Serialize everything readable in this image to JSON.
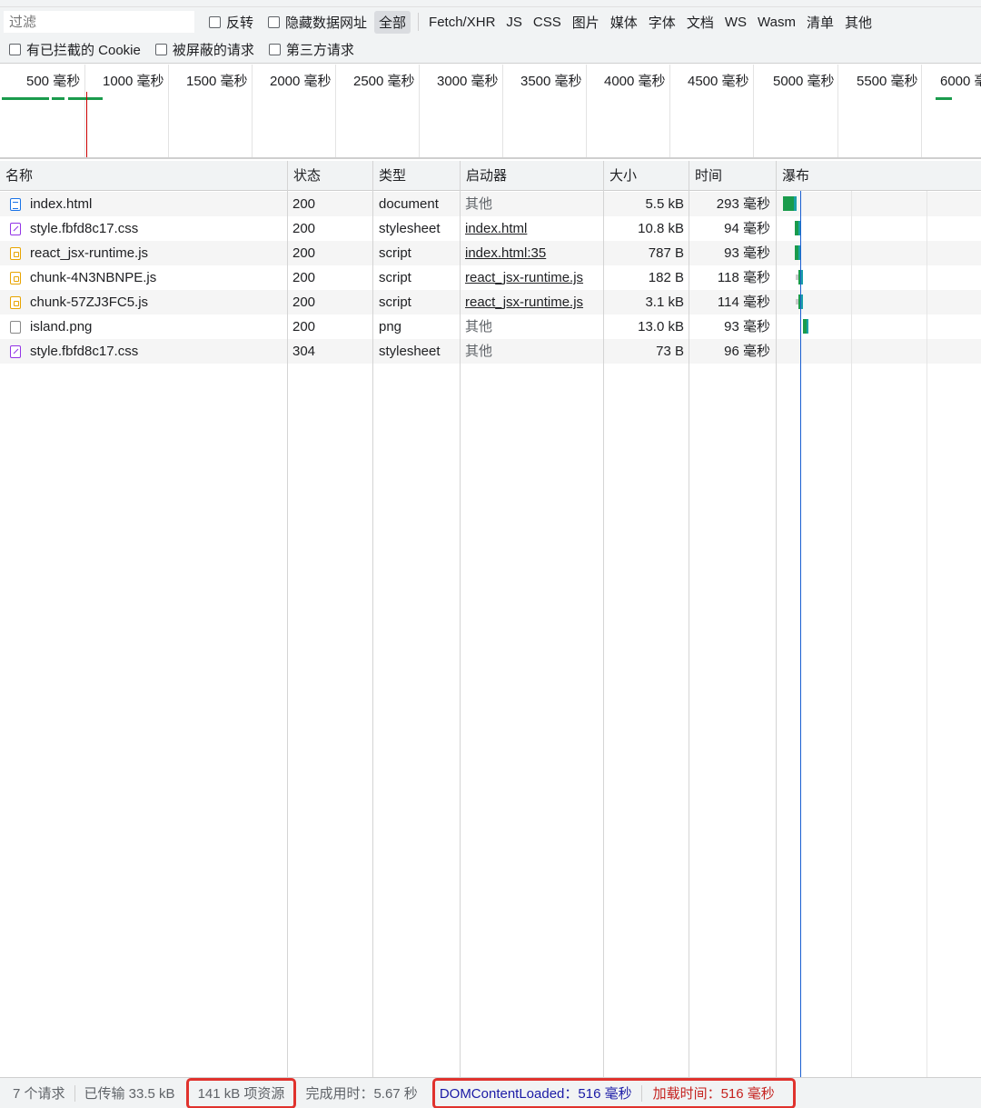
{
  "filter": {
    "placeholder": "过滤",
    "invert_label": "反转",
    "hide_data_urls_label": "隐藏数据网址",
    "types": [
      "全部",
      "Fetch/XHR",
      "JS",
      "CSS",
      "图片",
      "媒体",
      "字体",
      "文档",
      "WS",
      "Wasm",
      "清单",
      "其他"
    ],
    "blocked_cookies_label": "有已拦截的 Cookie",
    "blocked_requests_label": "被屏蔽的请求",
    "third_party_label": "第三方请求"
  },
  "overview": {
    "ticks": [
      "500 毫秒",
      "1000 毫秒",
      "1500 毫秒",
      "2000 毫秒",
      "2500 毫秒",
      "3000 毫秒",
      "3500 毫秒",
      "4000 毫秒",
      "4500 毫秒",
      "5000 毫秒",
      "5500 毫秒",
      "6000 毫"
    ]
  },
  "columns": {
    "name": "名称",
    "status": "状态",
    "type": "类型",
    "initiator": "启动器",
    "size": "大小",
    "time": "时间",
    "waterfall": "瀑布"
  },
  "rows": [
    {
      "name": "index.html",
      "icon": "document-icon",
      "status": "200",
      "type": "document",
      "initiator": "其他",
      "size": "5.5 kB",
      "time": "293 毫秒"
    },
    {
      "name": "style.fbfd8c17.css",
      "icon": "stylesheet-icon",
      "status": "200",
      "type": "stylesheet",
      "initiator": "index.html",
      "size": "10.8 kB",
      "time": "94 毫秒"
    },
    {
      "name": "react_jsx-runtime.js",
      "icon": "script-icon",
      "status": "200",
      "type": "script",
      "initiator": "index.html:35",
      "size": "787 B",
      "time": "93 毫秒"
    },
    {
      "name": "chunk-4N3NBNPE.js",
      "icon": "script-icon",
      "status": "200",
      "type": "script",
      "initiator": "react_jsx-runtime.js",
      "size": "182 B",
      "time": "118 毫秒"
    },
    {
      "name": "chunk-57ZJ3FC5.js",
      "icon": "script-icon",
      "status": "200",
      "type": "script",
      "initiator": "react_jsx-runtime.js",
      "size": "3.1 kB",
      "time": "114 毫秒"
    },
    {
      "name": "island.png",
      "icon": "image-icon",
      "status": "200",
      "type": "png",
      "initiator": "其他",
      "size": "13.0 kB",
      "time": "93 毫秒"
    },
    {
      "name": "style.fbfd8c17.css",
      "icon": "stylesheet-icon",
      "status": "304",
      "type": "stylesheet",
      "initiator": "其他",
      "size": "73 B",
      "time": "96 毫秒"
    }
  ],
  "status": {
    "requests": "7 个请求",
    "transferred": "已传输 33.5 kB",
    "resources": "141 kB 项资源",
    "finish": "完成用时：5.67 秒",
    "dom_content_loaded": "DOMContentLoaded：516 毫秒",
    "load": "加载时间：516 毫秒"
  },
  "colors": {
    "highlight_border": "#e0322d",
    "dcl_text": "#1a1aa6",
    "load_text": "#c5221f",
    "waterfall_wait": "#1a9b4c",
    "waterfall_download": "#1aa1a6"
  }
}
